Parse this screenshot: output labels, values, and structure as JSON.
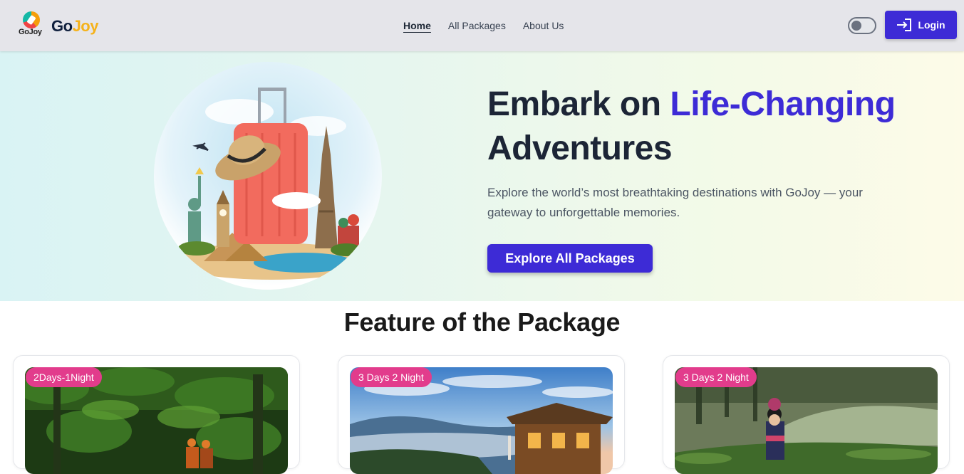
{
  "brand": {
    "logo_text": "GoJoy",
    "name_part1": "Go",
    "name_part2": "Joy"
  },
  "nav": {
    "links": [
      {
        "label": "Home",
        "active": true
      },
      {
        "label": "All Packages",
        "active": false
      },
      {
        "label": "About Us",
        "active": false
      }
    ]
  },
  "header": {
    "login_label": "Login",
    "theme_toggle_on": false
  },
  "hero": {
    "title_part1": "Embark on ",
    "title_accent": "Life-Changing",
    "title_part2": "Adventures",
    "subtitle": "Explore the world’s most breathtaking destinations with GoJoy — your gateway to unforgettable memories.",
    "cta_label": "Explore All Packages"
  },
  "features": {
    "title": "Feature of the Package",
    "cards": [
      {
        "badge": "2Days-1Night"
      },
      {
        "badge": "3 Days 2 Night"
      },
      {
        "badge": "3 Days 2 Night"
      }
    ]
  },
  "colors": {
    "primary": "#3d2bd6",
    "accent_yellow": "#f5b21b",
    "badge_pink": "#e23c8c",
    "nav_bg": "#e5e5ea"
  }
}
